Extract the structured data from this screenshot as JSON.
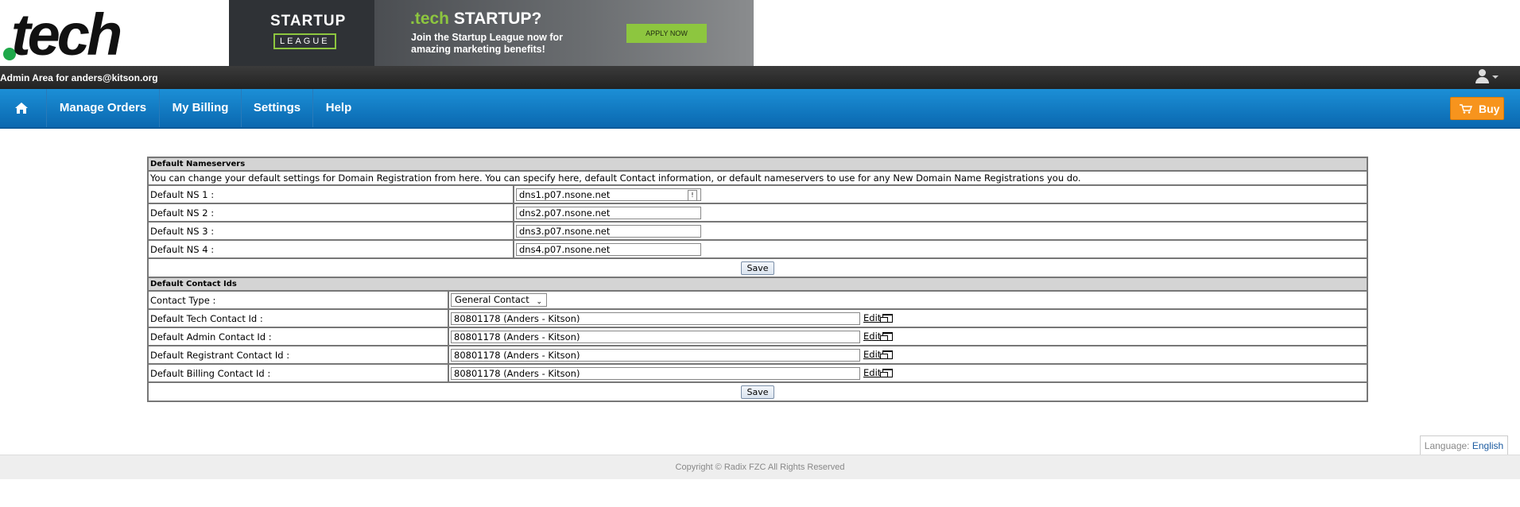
{
  "brand": {
    "logo_text": "tech"
  },
  "banner": {
    "league_top": "STARTUP",
    "league_bottom": "LEAGUE",
    "headline_prefix": ".tech",
    "headline_rest": " STARTUP?",
    "subtext": "Join the Startup League now for amazing marketing benefits!",
    "cta": "APPLY NOW"
  },
  "admin_bar": {
    "text": "Admin Area for anders@kitson.org"
  },
  "nav": {
    "items": [
      {
        "label": "Manage Orders"
      },
      {
        "label": "My Billing"
      },
      {
        "label": "Settings"
      },
      {
        "label": "Help"
      }
    ],
    "buy_label": "Buy"
  },
  "nameservers": {
    "section_title": "Default Nameservers",
    "description": "You can change your default settings for Domain Registration from here. You can specify here, default Contact information, or default nameservers to use for any New Domain Name Registrations you do.",
    "rows": [
      {
        "label": "Default NS 1 :",
        "value": "dns1.p07.nsone.net"
      },
      {
        "label": "Default NS 2 :",
        "value": "dns2.p07.nsone.net"
      },
      {
        "label": "Default NS 3 :",
        "value": "dns3.p07.nsone.net"
      },
      {
        "label": "Default NS 4 :",
        "value": "dns4.p07.nsone.net"
      }
    ],
    "save_label": "Save"
  },
  "contacts": {
    "section_title": "Default Contact Ids",
    "contact_type_label": "Contact Type :",
    "contact_type_value": "General Contact",
    "rows": [
      {
        "label": "Default Tech Contact Id :",
        "value": "80801178 (Anders - Kitson)",
        "edit": "Edit"
      },
      {
        "label": "Default Admin Contact Id :",
        "value": "80801178 (Anders - Kitson)",
        "edit": "Edit"
      },
      {
        "label": "Default Registrant Contact Id :",
        "value": "80801178 (Anders - Kitson)",
        "edit": "Edit"
      },
      {
        "label": "Default Billing Contact Id :",
        "value": "80801178 (Anders - Kitson)",
        "edit": "Edit"
      }
    ],
    "save_label": "Save"
  },
  "language": {
    "label": "Language:",
    "value": "English"
  },
  "footer": {
    "copyright": "Copyright © Radix FZC All Rights Reserved"
  }
}
